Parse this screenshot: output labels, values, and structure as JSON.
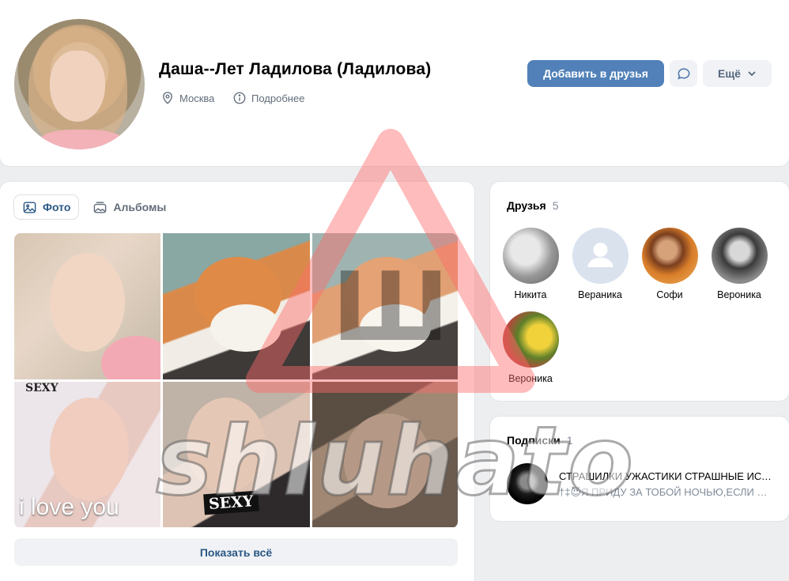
{
  "profile": {
    "name": "Даша--Лет Ладилова (Ладилова)",
    "city": "Москва",
    "details_link": "Подробнее",
    "icons": {
      "city": "location-pin-icon",
      "details": "info-icon"
    }
  },
  "actions": {
    "add_friend": "Добавить в друзья",
    "message_icon": "message-bubble-icon",
    "more": "Ещё",
    "more_icon": "chevron-down-icon"
  },
  "photos": {
    "tabs": [
      {
        "label": "Фото",
        "icon": "image-icon",
        "active": true
      },
      {
        "label": "Альбомы",
        "icon": "albums-icon",
        "active": false
      }
    ],
    "captions": {
      "sexy_top": "SEXY",
      "love": "i love you",
      "sexy_bottom": "SEXY"
    },
    "show_all": "Показать всё"
  },
  "friends": {
    "title": "Друзья",
    "count": "5",
    "items": [
      {
        "name": "Никита"
      },
      {
        "name": "Вераника"
      },
      {
        "name": "Софи"
      },
      {
        "name": "Вероника"
      },
      {
        "name": "Вероника"
      }
    ]
  },
  "subscriptions": {
    "title": "Подписки",
    "count": "1",
    "items": [
      {
        "title": "СТРАШИЛКИ УЖАСТИКИ СТРАШНЫЕ ИСТОРИИ",
        "description": "†‡😈Я ПРИДУ ЗА ТОБОЙ НОЧЬЮ,ЕСЛИ НЕ ПОДПИШЕШЬСЯ"
      }
    ]
  },
  "watermark": {
    "text": "shluhato",
    "letter": "Ш"
  },
  "colors": {
    "accent": "#5181b8",
    "link": "#2a5885",
    "secondary_text": "#626d7a",
    "page_bg": "#edeef0",
    "watermark_red": "#ff6b6b"
  }
}
